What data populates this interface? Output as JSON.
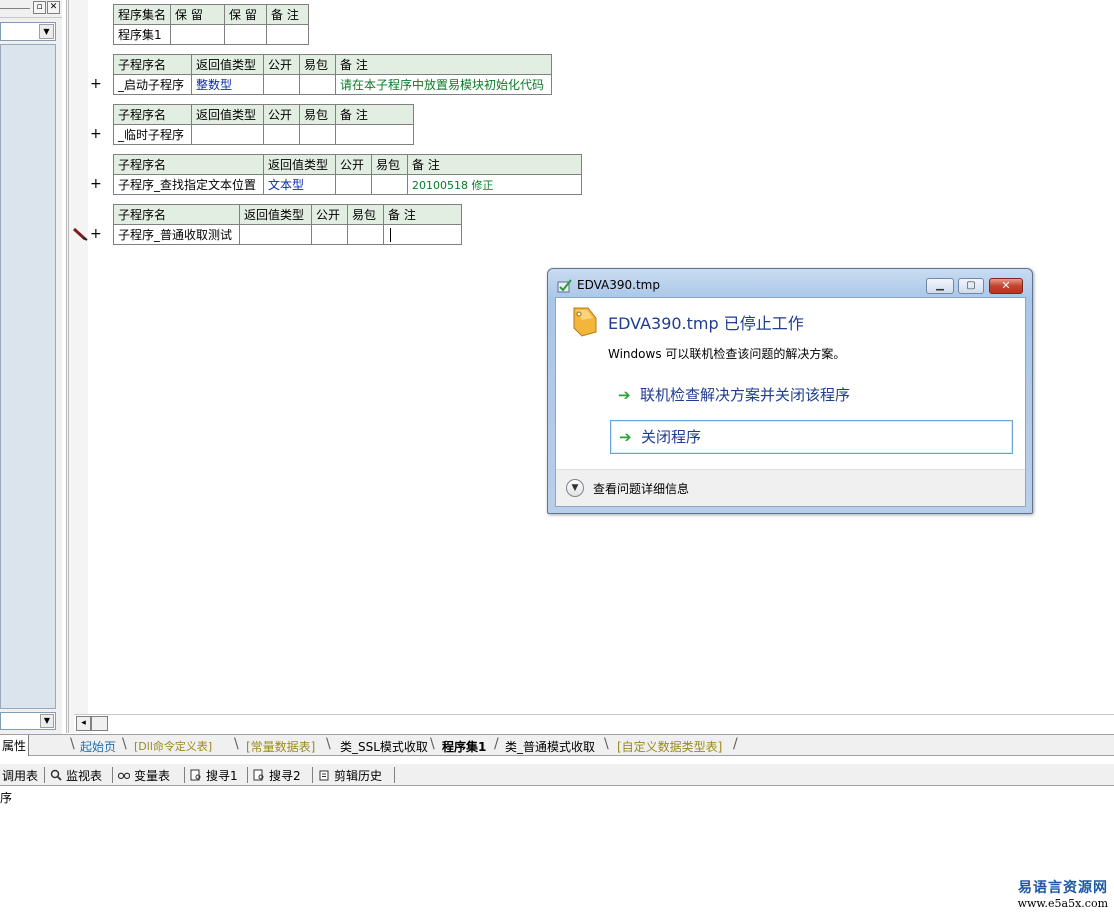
{
  "left_panel": {
    "property_tab": "属性",
    "bottom_text": "序"
  },
  "assembly_table": {
    "headers": [
      "程序集名",
      "保 留",
      "保 留",
      "备 注"
    ],
    "row": [
      "程序集1",
      "",
      "",
      ""
    ]
  },
  "sub_tables": [
    {
      "headers": [
        "子程序名",
        "返回值类型",
        "公开",
        "易包",
        "备 注"
      ],
      "row": [
        "_启动子程序",
        "整数型",
        "",
        "",
        "请在本子程序中放置易模块初始化代码"
      ]
    },
    {
      "headers": [
        "子程序名",
        "返回值类型",
        "公开",
        "易包",
        "备 注"
      ],
      "row": [
        "_临时子程序",
        "",
        "",
        "",
        ""
      ]
    },
    {
      "headers": [
        "子程序名",
        "返回值类型",
        "公开",
        "易包",
        "备 注"
      ],
      "row": [
        "子程序_查找指定文本位置",
        "文本型",
        "",
        "",
        "20100518 修正"
      ]
    },
    {
      "headers": [
        "子程序名",
        "返回值类型",
        "公开",
        "易包",
        "备 注"
      ],
      "row": [
        "子程序_普通收取测试",
        "",
        "",
        "",
        ""
      ]
    }
  ],
  "gutter": {
    "expand_symbol": "+"
  },
  "tabs": [
    {
      "label": "起始页",
      "color": "#1e6fb0"
    },
    {
      "label": "[Dll命令定义表]",
      "color": "#9a8a1e"
    },
    {
      "label": "[常量数据表]",
      "color": "#9a8a1e"
    },
    {
      "label": "类_SSL模式收取",
      "color": "#000000"
    },
    {
      "label": "程序集1",
      "color": "#000000"
    },
    {
      "label": "类_普通模式收取",
      "color": "#000000"
    },
    {
      "label": "[自定义数据类型表]",
      "color": "#9a8a1e"
    }
  ],
  "bottom_toolbar": [
    "调用表",
    "监视表",
    "变量表",
    "搜寻1",
    "搜寻2",
    "剪辑历史"
  ],
  "dialog": {
    "title": "EDVA390.tmp",
    "heading": "EDVA390.tmp 已停止工作",
    "message": "Windows 可以联机检查该问题的解决方案。",
    "option_check": "联机检查解决方案并关闭该程序",
    "option_close": "关闭程序",
    "details": "查看问题详细信息"
  },
  "watermark": {
    "name": "易语言资源网",
    "url": "www.e5a5x.com"
  }
}
